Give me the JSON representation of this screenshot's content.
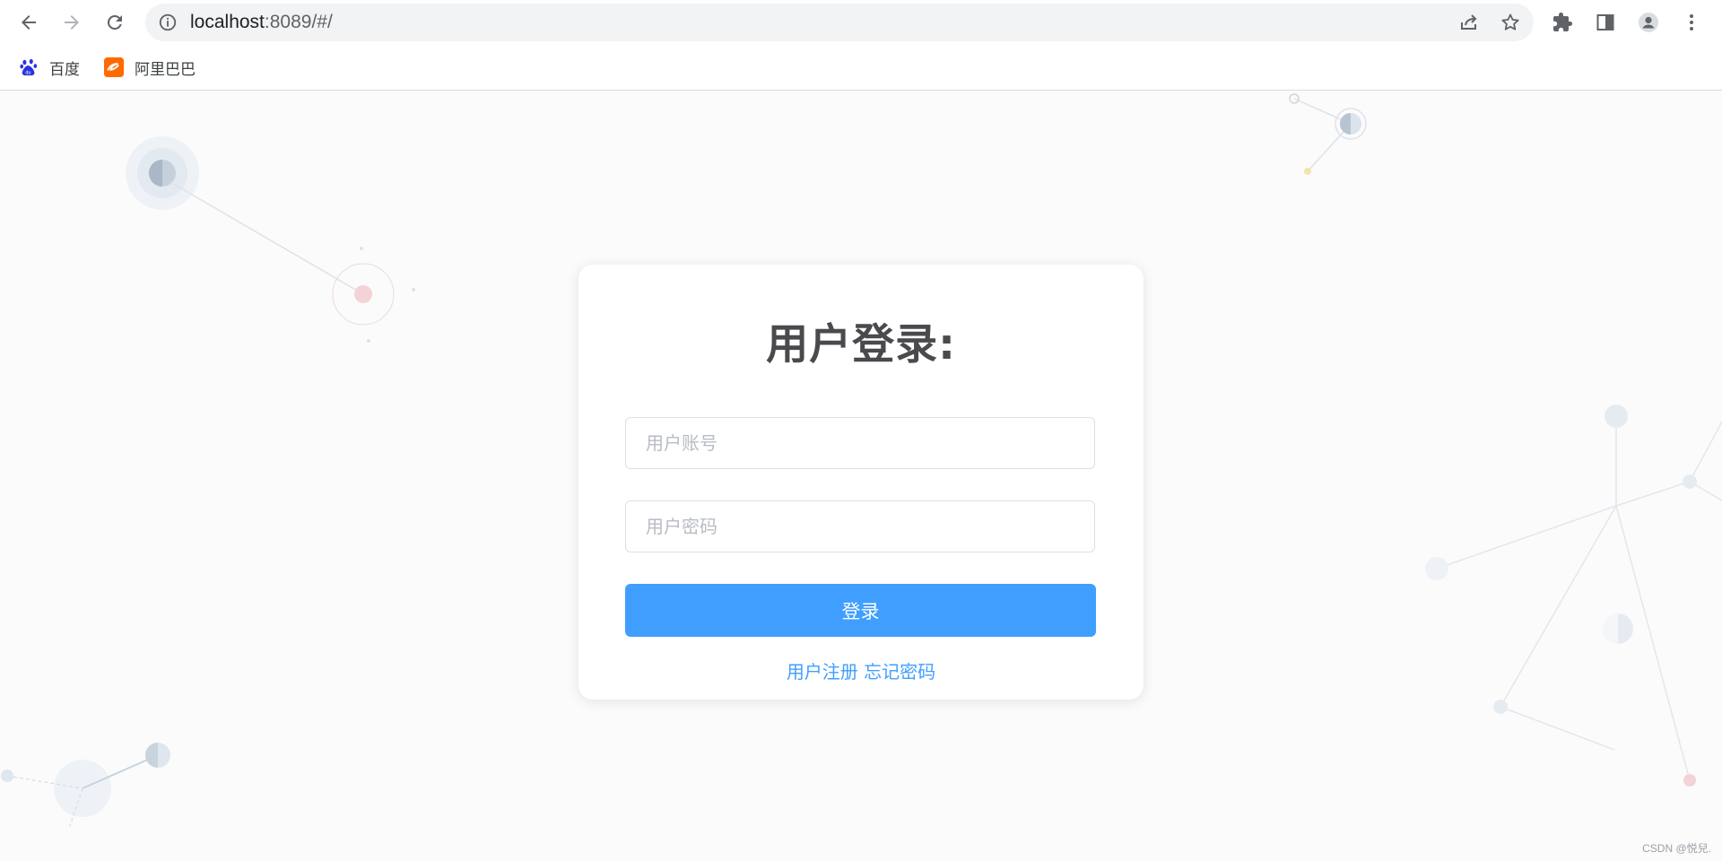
{
  "browser": {
    "url_host": "localhost",
    "url_rest": ":8089/#/",
    "bookmarks": [
      {
        "label": "百度",
        "icon": "baidu-paw-icon"
      },
      {
        "label": "阿里巴巴",
        "icon": "alibaba-icon"
      }
    ],
    "colors": {
      "toolbar_icon": "#5f6368",
      "omnibox_bg": "#f1f3f4"
    }
  },
  "login": {
    "title": "用户登录:",
    "username_placeholder": "用户账号",
    "password_placeholder": "用户密码",
    "submit_label": "登录",
    "register_link": "用户注册",
    "forgot_link": "忘记密码",
    "accent_color": "#409eff"
  },
  "watermark": "CSDN @悦兒."
}
